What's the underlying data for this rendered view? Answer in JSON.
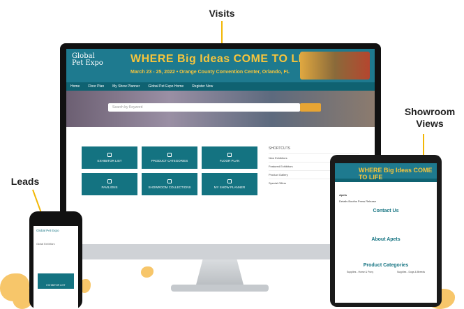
{
  "callouts": {
    "visits": "Visits",
    "showroom_line1": "Showroom",
    "showroom_line2": "Views",
    "leads": "Leads"
  },
  "colors": {
    "accent": "#f2b705",
    "teal": "#147381",
    "banner": "#1e7a8f",
    "headline_gold": "#f7c53c"
  },
  "monitor": {
    "logo_line1": "Global",
    "logo_line2": "Pet Expo",
    "headline": "WHERE Big Ideas COME TO LIFE",
    "subheadline": "March 23 - 25, 2022 • Orange County Convention Center, Orlando, FL",
    "nav": [
      "Home",
      "Floor Plan",
      "My Show Planner",
      "Global Pet Expo Home",
      "Register Now"
    ],
    "search_placeholder": "Search by Keyword",
    "tiles": [
      "EXHIBITOR LIST",
      "PRODUCT CATEGORIES",
      "FLOOR PLAN",
      "PAVILIONS",
      "SHOWROOM COLLECTIONS",
      "MY SHOW PLANNER"
    ],
    "shortcuts_title": "SHORTCUTS",
    "shortcuts": [
      "New Exhibitors",
      "Featured Exhibitors",
      "Product Gallery",
      "Special Offers"
    ]
  },
  "tablet": {
    "headline": "WHERE Big Ideas COME TO LIFE",
    "company": "Apets",
    "tabs": "Details   Booths   Press Release",
    "contact_heading": "Contact Us",
    "about_heading": "About Apets",
    "categories_heading": "Product Categories",
    "categories": [
      "Supplies - Horse & Pony",
      "Supplies - Dogs & Breeds"
    ]
  },
  "phone": {
    "logo": "Global Pet Expo",
    "line": "Global Exhibitors",
    "button_label": "EXHIBITOR LIST"
  }
}
